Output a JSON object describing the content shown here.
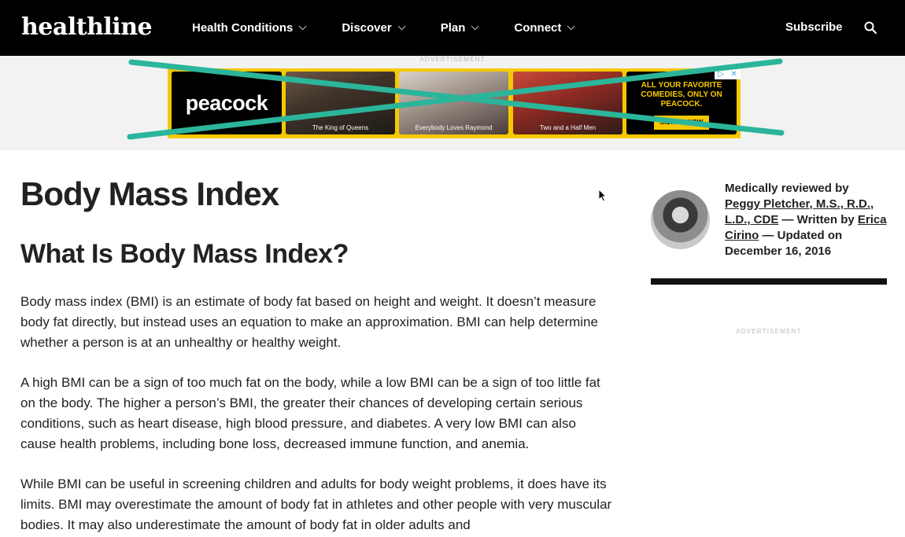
{
  "header": {
    "logo": "healthline",
    "nav": [
      "Health Conditions",
      "Discover",
      "Plan",
      "Connect"
    ],
    "subscribe": "Subscribe"
  },
  "top_ad": {
    "label": "ADVERTISEMENT",
    "brand": "peacock",
    "shows": [
      "The King of Queens",
      "Everybody Loves Raymond",
      "Two and a Half Men"
    ],
    "cta_text": "ALL YOUR FAVORITE COMEDIES, ONLY ON PEACOCK.",
    "cta_button": "SIGN UP NOW",
    "colors": {
      "background": "#f6c800",
      "cross": "#2bb59b"
    }
  },
  "article": {
    "title": "Body Mass Index",
    "section_title": "What Is Body Mass Index?",
    "paragraphs": [
      "Body mass index (BMI) is an estimate of body fat based on height and weight. It doesn’t measure body fat directly, but instead uses an equation to make an approximation. BMI can help determine whether a person is at an unhealthy or healthy weight.",
      "A high BMI can be a sign of too much fat on the body, while a low BMI can be a sign of too little fat on the body. The higher a person’s BMI, the greater their chances of developing certain serious conditions, such as heart disease, high blood pressure, and diabetes. A very low BMI can also cause health problems, including bone loss, decreased immune function, and anemia.",
      "While BMI can be useful in screening children and adults for body weight problems, it does have its limits. BMI may overestimate the amount of body fat in athletes and other people with very muscular bodies. It may also underestimate the amount of body fat in older adults and"
    ]
  },
  "sidebar": {
    "reviewed_prefix": "Medically reviewed by",
    "reviewer": "Peggy Pletcher, M.S., R.D., L.D., CDE",
    "written_prefix": " — Written by ",
    "author": "Erica Cirino",
    "updated": " — Updated on December 16, 2016",
    "ad_label": "ADVERTISEMENT"
  }
}
